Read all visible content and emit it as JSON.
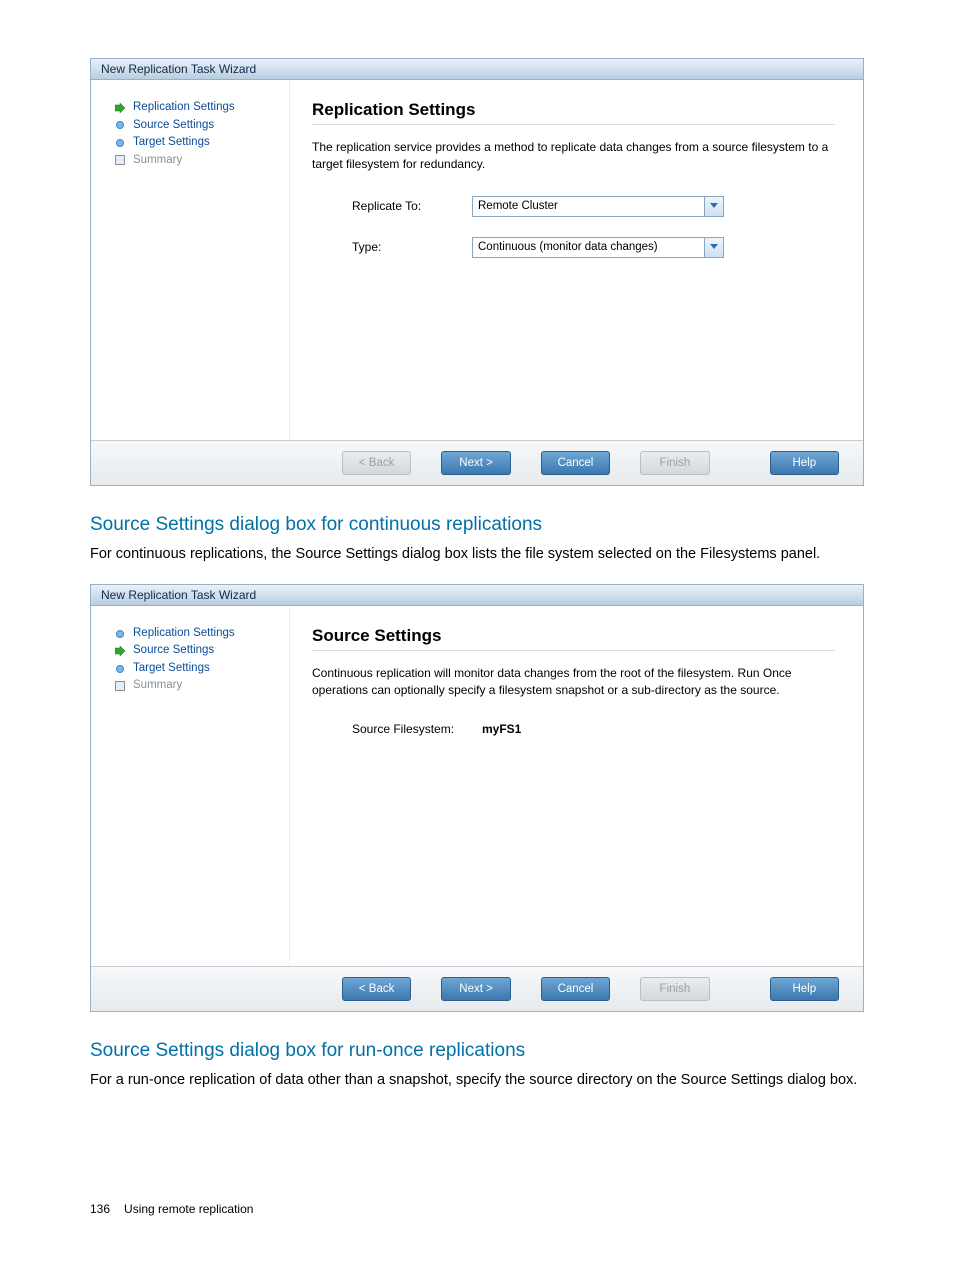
{
  "wizard1": {
    "title": "New Replication Task Wizard",
    "nav": {
      "items": [
        {
          "label": "Replication Settings",
          "icon": "arrow",
          "style": "link"
        },
        {
          "label": "Source Settings",
          "icon": "dot",
          "style": "link"
        },
        {
          "label": "Target Settings",
          "icon": "dot",
          "style": "link"
        },
        {
          "label": "Summary",
          "icon": "rect",
          "style": "muted"
        }
      ]
    },
    "main": {
      "title": "Replication Settings",
      "desc": "The replication service provides a method to replicate data changes from a source filesystem to a target filesystem for redundancy.",
      "replicate_to_label": "Replicate To:",
      "replicate_to_value": "Remote Cluster",
      "type_label": "Type:",
      "type_value": "Continuous (monitor data changes)"
    },
    "footer": {
      "back": "< Back",
      "next": "Next >",
      "cancel": "Cancel",
      "finish": "Finish",
      "help": "Help",
      "back_enabled": false,
      "finish_enabled": false
    }
  },
  "section1": {
    "heading": "Source Settings dialog box for continuous replications",
    "text": "For continuous replications, the Source Settings dialog box lists the file system selected on the Filesystems panel."
  },
  "wizard2": {
    "title": "New Replication Task Wizard",
    "nav": {
      "items": [
        {
          "label": "Replication Settings",
          "icon": "dot",
          "style": "link"
        },
        {
          "label": "Source Settings",
          "icon": "arrow",
          "style": "link"
        },
        {
          "label": "Target Settings",
          "icon": "dot",
          "style": "link"
        },
        {
          "label": "Summary",
          "icon": "rect",
          "style": "muted"
        }
      ]
    },
    "main": {
      "title": "Source Settings",
      "desc": "Continuous replication will monitor data changes from the root of the filesystem. Run Once operations can optionally specify a filesystem snapshot or a sub-directory as the source.",
      "source_fs_label": "Source Filesystem:",
      "source_fs_value": "myFS1"
    },
    "footer": {
      "back": "< Back",
      "next": "Next >",
      "cancel": "Cancel",
      "finish": "Finish",
      "help": "Help",
      "back_enabled": true,
      "finish_enabled": false
    }
  },
  "section2": {
    "heading": "Source Settings dialog box for run-once replications",
    "text": "For a run-once replication of data other than a snapshot, specify the source directory on the Source Settings dialog box."
  },
  "page_footer": {
    "number": "136",
    "title": "Using remote replication"
  },
  "icons": {
    "arrow_svg": "arrow",
    "chevron_svg": "chevron"
  }
}
